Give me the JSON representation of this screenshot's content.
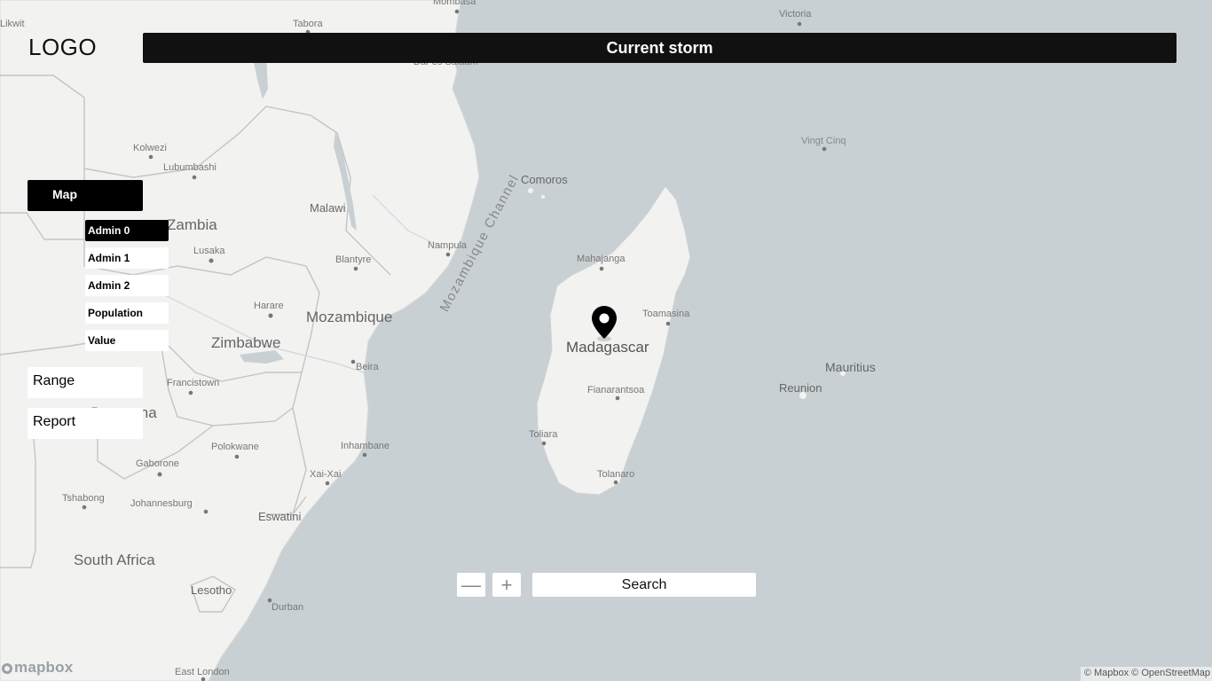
{
  "header": {
    "logo": "LOGO",
    "title": "Current storm"
  },
  "sidebar": {
    "map_label": "Map",
    "layers": [
      {
        "label": "Admin 0",
        "active": true
      },
      {
        "label": "Admin 1",
        "active": false
      },
      {
        "label": "Admin 2",
        "active": false
      },
      {
        "label": "Population",
        "active": false
      },
      {
        "label": "Value",
        "active": false
      }
    ],
    "range_label": "Range",
    "report_label": "Report"
  },
  "controls": {
    "zoom_out": "—",
    "zoom_in": "+",
    "search_label": "Search"
  },
  "map": {
    "marker_icon": "map-pin-icon",
    "colors": {
      "water": "#c9d0d3",
      "land": "#f2f2f1",
      "marker": "#000000"
    },
    "labels": {
      "countries": [
        "Zambia",
        "Malawi",
        "Mozambique",
        "Zimbabwe",
        "Botswana",
        "South Africa",
        "Madagascar",
        "Mauritius",
        "Reunion",
        "Comoros",
        "Eswatini",
        "Lesotho"
      ],
      "water": [
        "Mozambique Channel"
      ],
      "cities": [
        "Mombasa",
        "Tabora",
        "Victoria",
        "Dar es Salaam",
        "Kolwezi",
        "Lubumbashi",
        "Lusaka",
        "Blantyre",
        "Harare",
        "Nampula",
        "Beira",
        "Francistown",
        "Polokwane",
        "Gaborone",
        "Inhambane",
        "Xai-Xai",
        "Tshabong",
        "Johannesburg",
        "Durban",
        "East London",
        "Mahajanga",
        "Toamasina",
        "Fianarantsoa",
        "Toliara",
        "Tolanaro",
        "Vingt Cinq",
        "Likwit"
      ]
    }
  },
  "footer": {
    "mapbox_logo": "mapbox",
    "attribution": "© Mapbox © OpenStreetMap"
  }
}
